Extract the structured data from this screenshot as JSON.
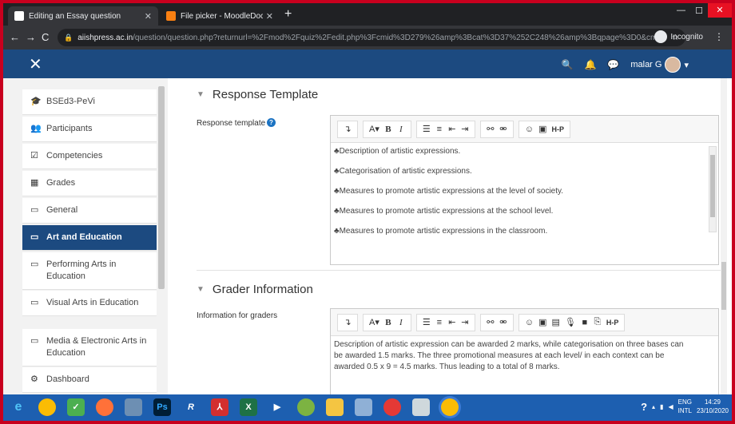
{
  "browser": {
    "tabs": [
      {
        "title": "Editing an Essay question",
        "active": true,
        "favicon_color": "#ffffff"
      },
      {
        "title": "File picker - MoodleDocs",
        "active": false,
        "favicon_color": "#f98012"
      }
    ],
    "new_tab": "+",
    "url_domain": "aiishpress.ac.in",
    "url_path": "/question/question.php?returnurl=%2Fmod%2Fquiz%2Fedit.php%3Fcmid%3D279%26amp%3Bcat%3D37%252C248%26amp%3Bqpage%3D0&cmid=27...",
    "incognito_label": "Incognito"
  },
  "navbar": {
    "user_name": "malar G",
    "icons": [
      "search-icon",
      "bell-icon",
      "chat-icon",
      "caret-down-icon"
    ]
  },
  "drawer": {
    "items": [
      {
        "label": "BSEd3-PeVi",
        "icon": "graduation-cap-icon",
        "glyph": "🎓",
        "active": false
      },
      {
        "label": "Participants",
        "icon": "users-icon",
        "glyph": "👥",
        "active": false
      },
      {
        "label": "Competencies",
        "icon": "checkbox-icon",
        "glyph": "☑",
        "active": false
      },
      {
        "label": "Grades",
        "icon": "table-icon",
        "glyph": "▦",
        "active": false
      },
      {
        "label": "General",
        "icon": "folder-icon",
        "glyph": "▭",
        "active": false
      },
      {
        "label": "Art and Education",
        "icon": "folder-icon",
        "glyph": "▭",
        "active": true
      },
      {
        "label": "Performing Arts in Education",
        "icon": "folder-icon",
        "glyph": "▭",
        "active": false
      },
      {
        "label": "Visual Arts in Education",
        "icon": "folder-icon",
        "glyph": "▭",
        "active": false
      },
      {
        "label": "Media & Electronic Arts in Education",
        "icon": "folder-icon",
        "glyph": "▭",
        "active": false
      },
      {
        "label": "Dashboard",
        "icon": "dashboard-icon",
        "glyph": "⚙",
        "active": false
      }
    ]
  },
  "main": {
    "response_template": {
      "heading": "Response Template",
      "label": "Response template",
      "lines": [
        "Description of artistic expressions.",
        "Categorisation of artistic expressions.",
        "Measures to promote artistic expressions at the level of society.",
        "Measures to promote artistic expressions at the school level.",
        "Measures to promote artistic expressions in the classroom."
      ]
    },
    "grader_info": {
      "heading": "Grader Information",
      "label": "Information for graders",
      "text": "Description of artistic expression can be awarded 2 marks, while categorisation on three bases can be awarded 1.5 marks. The three promotional measures at each level/ in each context can be awarded 0.5 x 9 = 4.5 marks. Thus leading to a total of 8 marks."
    }
  },
  "taskbar": {
    "lang_top": "ENG",
    "lang_bottom": "INTL",
    "time": "14:29",
    "date": "23/10/2020"
  }
}
